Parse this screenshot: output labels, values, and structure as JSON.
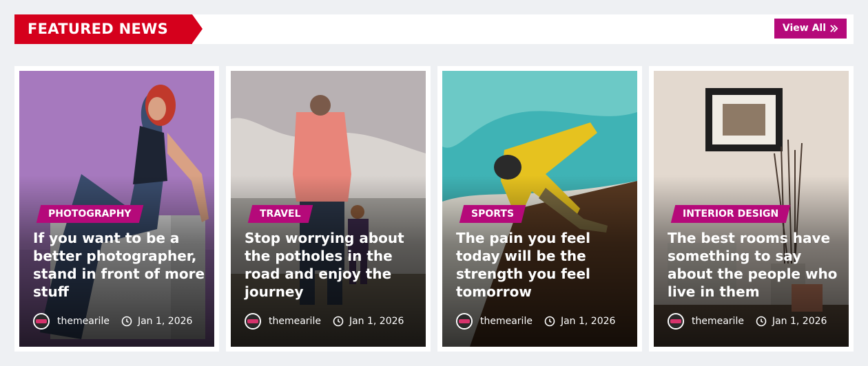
{
  "header": {
    "title": "FEATURED NEWS",
    "view_all": "View All",
    "accent": "#d5001c",
    "button_color": "#b5097a"
  },
  "cards": [
    {
      "category": "PHOTOGRAPHY",
      "title": "If you want to be a better photographer, stand in front of more stuff",
      "author": "themearile",
      "date": "Jan 1, 2026"
    },
    {
      "category": "TRAVEL",
      "title": "Stop worrying about the potholes in the road and enjoy the journey",
      "author": "themearile",
      "date": "Jan 1, 2026"
    },
    {
      "category": "SPORTS",
      "title": "The pain you feel today will be the strength you feel tomorrow",
      "author": "themearile",
      "date": "Jan 1, 2026"
    },
    {
      "category": "INTERIOR DESIGN",
      "title": "The best rooms have something to say about the people who live in them",
      "author": "themearile",
      "date": "Jan 1, 2026"
    }
  ]
}
